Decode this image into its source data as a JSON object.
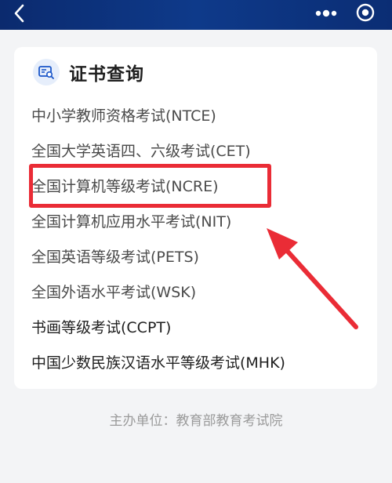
{
  "topbar": {
    "back_icon": "chevron-left-icon",
    "more_icon": "more-dots-icon",
    "target_icon": "target-circle-icon",
    "color": "#0e3a8a"
  },
  "card": {
    "icon": "certificate-search-icon",
    "title": "证书查询",
    "items": [
      {
        "label": "中小学教师资格考试(NTCE)"
      },
      {
        "label": "全国大学英语四、六级考试(CET)"
      },
      {
        "label": "全国计算机等级考试(NCRE)"
      },
      {
        "label": "全国计算机应用水平考试(NIT)"
      },
      {
        "label": "全国英语等级考试(PETS)"
      },
      {
        "label": "全国外语水平考试(WSK)"
      },
      {
        "label": "书画等级考试(CCPT)"
      },
      {
        "label": "中国少数民族汉语水平等级考试(MHK)"
      }
    ]
  },
  "annotation": {
    "highlight_color": "#ea2c36",
    "highlighted_item": "全国计算机等级考试(NCRE)"
  },
  "footer": {
    "text": "主办单位：教育部教育考试院"
  }
}
